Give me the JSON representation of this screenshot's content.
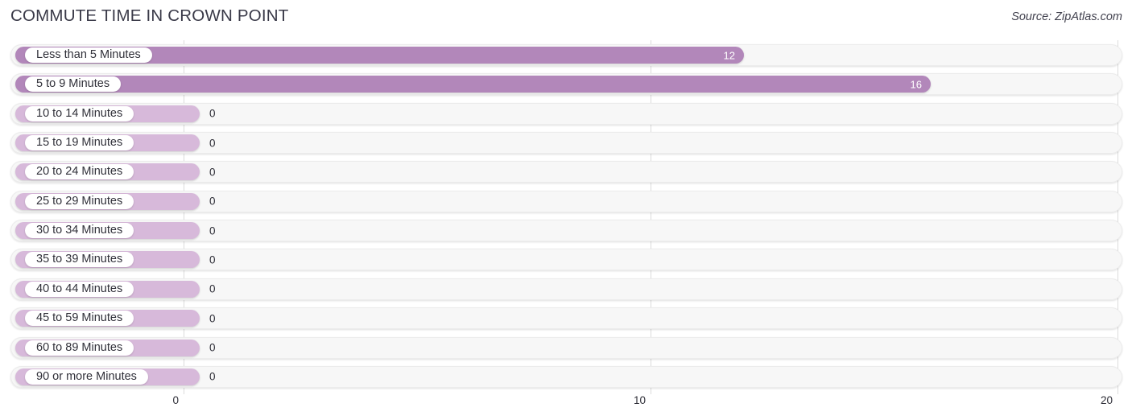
{
  "header": {
    "title": "COMMUTE TIME IN CROWN POINT",
    "source": "Source: ZipAtlas.com"
  },
  "colors": {
    "bar_filled": "#b287ba",
    "bar_empty": "#d7b9da",
    "track": "#f7f7f7",
    "gridline": "#dcdcdc",
    "title_text": "#3a3a48",
    "value_inside_text": "#ffffff",
    "value_outside_text": "#2f2f38"
  },
  "chart_data": {
    "type": "bar",
    "orientation": "horizontal",
    "title": "COMMUTE TIME IN CROWN POINT",
    "xlabel": "",
    "ylabel": "",
    "xlim": [
      0,
      20
    ],
    "xticks": [
      0,
      10,
      20
    ],
    "xtick_labels": [
      "0",
      "10",
      "20"
    ],
    "grid": true,
    "legend": "none",
    "categories": [
      "Less than 5 Minutes",
      "5 to 9 Minutes",
      "10 to 14 Minutes",
      "15 to 19 Minutes",
      "20 to 24 Minutes",
      "25 to 29 Minutes",
      "30 to 34 Minutes",
      "35 to 39 Minutes",
      "40 to 44 Minutes",
      "45 to 59 Minutes",
      "60 to 89 Minutes",
      "90 or more Minutes"
    ],
    "values": [
      12,
      16,
      0,
      0,
      0,
      0,
      0,
      0,
      0,
      0,
      0,
      0
    ],
    "value_labels": [
      "12",
      "16",
      "0",
      "0",
      "0",
      "0",
      "0",
      "0",
      "0",
      "0",
      "0",
      "0"
    ]
  }
}
